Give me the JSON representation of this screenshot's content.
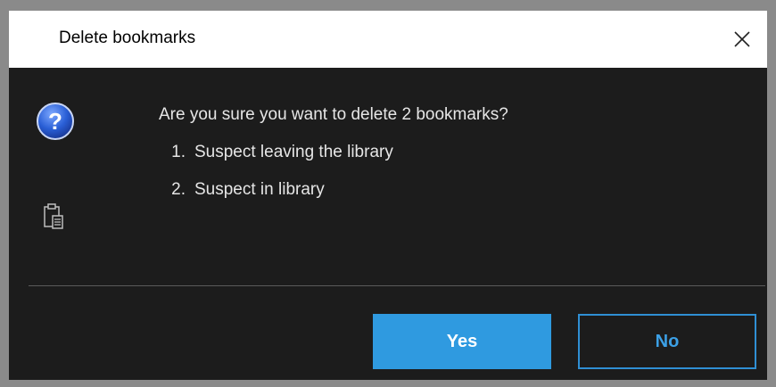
{
  "window": {
    "title": "Delete bookmarks",
    "close_icon": "close-icon"
  },
  "dialog": {
    "icon": "question-icon",
    "question": "Are you sure you want to delete 2 bookmarks?",
    "items": [
      {
        "number": "1.",
        "label": "Suspect leaving the library"
      },
      {
        "number": "2.",
        "label": "Suspect in library"
      }
    ],
    "copy_icon": "clipboard-copy-icon"
  },
  "buttons": {
    "yes_label": "Yes",
    "no_label": "No"
  },
  "colors": {
    "background": "#1c1c1c",
    "accent": "#2f9ae0",
    "text": "#e6e6e6"
  }
}
